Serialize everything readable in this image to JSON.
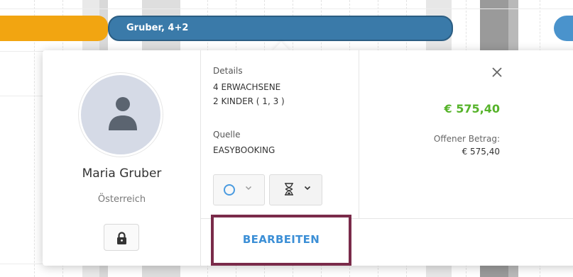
{
  "calendar": {
    "reservation_bar_label": "Gruber, 4+2"
  },
  "guest": {
    "name": "Maria Gruber",
    "country": "Österreich",
    "avatar_icon": "person-icon",
    "lock_icon": "lock-icon"
  },
  "details": {
    "details_label": "Details",
    "adults": "4 ERWACHSENE",
    "children": "2 KINDER ( 1, 3 )",
    "source_label": "Quelle",
    "source_value": "EASYBOOKING",
    "status_icon": "circle-icon",
    "timer_icon": "hourglass-icon"
  },
  "price": {
    "total": "€ 575,40",
    "open_label": "Offener Betrag:",
    "open_amount": "€ 575,40"
  },
  "actions": {
    "close_icon": "close-icon",
    "edit_label": "BEARBEITEN"
  },
  "colors": {
    "accent_blue": "#3a7aa9",
    "bar_orange": "#f2a511",
    "bar_red": "#e53238",
    "price_green": "#56b32a",
    "highlight_frame": "#7a2b4a"
  }
}
